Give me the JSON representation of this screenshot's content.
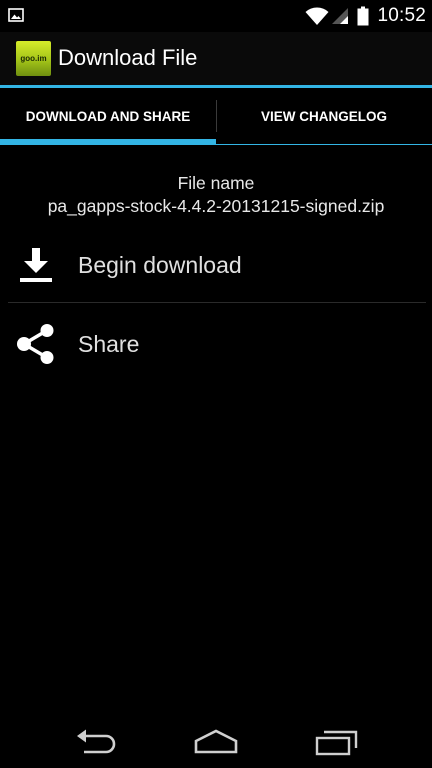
{
  "status_bar": {
    "time": "10:52",
    "icons": [
      "image-notification-icon",
      "wifi-icon",
      "signal-icon",
      "battery-icon"
    ]
  },
  "action_bar": {
    "logo_text": "goo.im",
    "title": "Download File"
  },
  "tabs": [
    {
      "label": "DOWNLOAD AND SHARE",
      "selected": true
    },
    {
      "label": "VIEW CHANGELOG",
      "selected": false
    }
  ],
  "file": {
    "label": "File name",
    "name": "pa_gapps-stock-4.4.2-20131215-signed.zip"
  },
  "actions": [
    {
      "label": "Begin download",
      "icon": "download-icon"
    },
    {
      "label": "Share",
      "icon": "share-icon"
    }
  ],
  "nav": {
    "icons": [
      "back-icon",
      "home-icon",
      "recent-apps-icon"
    ]
  },
  "colors": {
    "accent": "#33b5e5",
    "background": "#000000",
    "logo": "#a3c419"
  }
}
